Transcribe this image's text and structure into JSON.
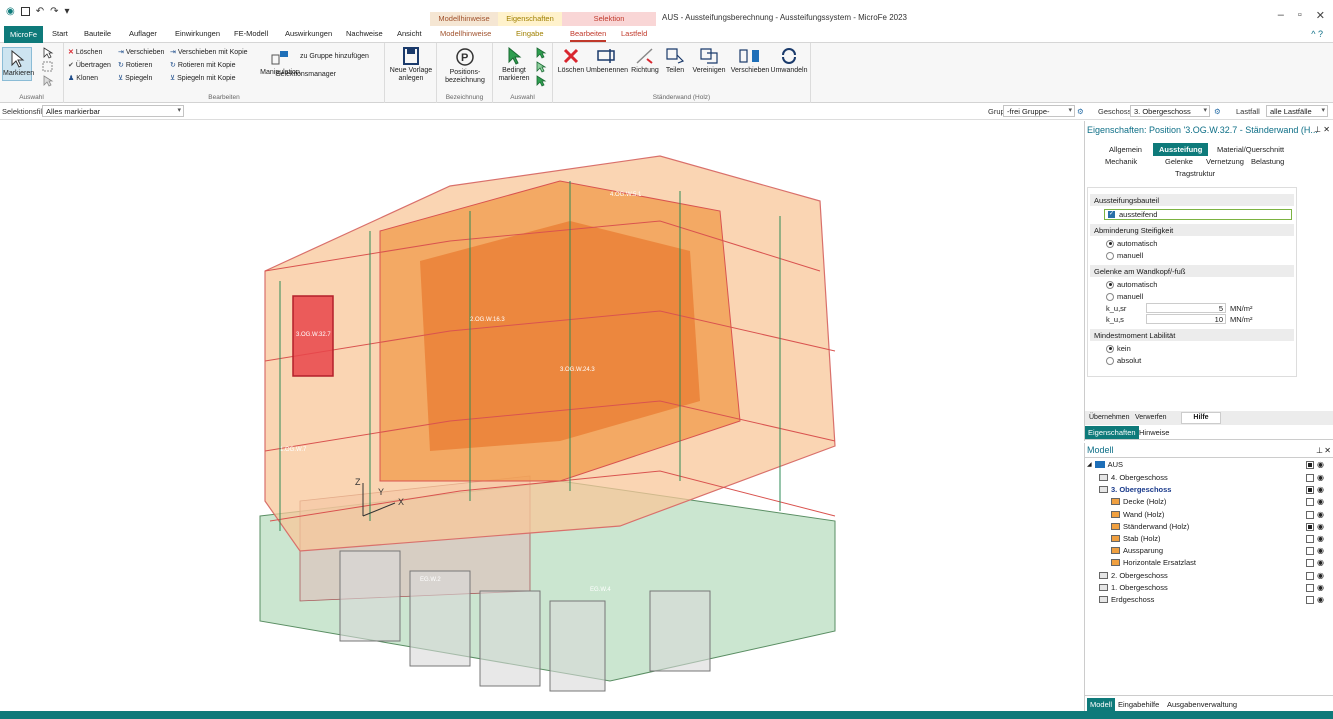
{
  "titlebar": {
    "quick_access": [
      "◉",
      "💾",
      "↶",
      "↷",
      "▾"
    ],
    "window_title": "AUS - Aussteifungsberechnung - Aussteifungssystem - MicroFe 2023",
    "context_groups": [
      {
        "label": "Modellhinweise",
        "color": "#f5e6d3"
      },
      {
        "label": "Eigenschaften",
        "color": "#fff2cc"
      },
      {
        "label": "Selektion",
        "color": "#f9d6d6"
      }
    ],
    "controls": [
      "–",
      "▫",
      "✕"
    ]
  },
  "tabs": {
    "app": "MicroFe",
    "items": [
      "Start",
      "Bauteile",
      "Auflager",
      "Einwirkungen",
      "FE-Modell",
      "Auswirkungen",
      "Nachweise",
      "Ansicht",
      "Modellhinweise",
      "Eingabe",
      "Bearbeiten",
      "Lastfeld"
    ],
    "help": "^ ?"
  },
  "ribbon": {
    "auswahl": {
      "label": "Auswahl",
      "markieren": "Markieren"
    },
    "bearbeiten": {
      "label": "Bearbeiten",
      "loeschen": "Löschen",
      "uebertragen": "Übertragen",
      "klonen": "Klonen",
      "verschieben": "Verschieben",
      "rotieren": "Rotieren",
      "spiegeln": "Spiegeln",
      "verschieben_kopie": "Verschieben mit Kopie",
      "rotieren_kopie": "Rotieren mit Kopie",
      "spiegeln_kopie": "Spiegeln mit Kopie",
      "manipulation": "Manipulation",
      "gruppe": "zu Gruppe hinzufügen",
      "selektionsmanager": "Selektionsmanager",
      "neue_vorlage": "Neue Vorlage anlegen"
    },
    "bezeichnung": {
      "label": "Bezeichnung",
      "positions": "Positions-bezeichnung"
    },
    "auswahl2": {
      "label": "Auswahl",
      "bedingt": "Bedingt markieren"
    },
    "staenderwand": {
      "label": "Ständerwand (Holz)",
      "items": [
        "Löschen",
        "Umbenennen",
        "Richtung",
        "Teilen",
        "Vereinigen",
        "Verschieben",
        "Umwandeln"
      ]
    }
  },
  "selbar": {
    "filter_label": "Selektionsfilter",
    "filter_value": "Alles markierbar",
    "gruppe_label": "Gruppe",
    "gruppe_value": "-frei Gruppe-",
    "geschoss_label": "Geschoss",
    "geschoss_value": "3. Obergeschoss",
    "lastfall_label": "Lastfall",
    "lastfall_value": "alle Lastfälle"
  },
  "props": {
    "title": "Eigenschaften: Position '3.OG.W.32.7 - Ständerwand (H...",
    "tabs": [
      "Allgemein",
      "Aussteifung",
      "Material/Querschnitt",
      "Mechanik",
      "Gelenke",
      "Vernetzung",
      "Belastung",
      "Tragstruktur"
    ],
    "active_tab": "Aussteifung",
    "sections": {
      "aussteifungsbauteil": "Aussteifungsbauteil",
      "aussteifend": "aussteifend",
      "abminderung": "Abminderung Steifigkeit",
      "automatisch": "automatisch",
      "manuell": "manuell",
      "gelenke": "Gelenke am Wandkopf/-fuß",
      "k_u_sr": "k_u,sr",
      "k_u_sr_val": "5",
      "k_u_s": "k_u,s",
      "k_u_s_val": "10",
      "unit": "MN/m²",
      "mindestmoment": "Mindestmoment Labilität",
      "kein": "kein",
      "absolut": "absolut"
    },
    "buttons": [
      "Übernehmen",
      "Verwerfen",
      "Hilfe"
    ],
    "bottom_tabs": [
      "Eigenschaften",
      "Hinweise"
    ]
  },
  "modell": {
    "title": "Modell",
    "root": "AUS",
    "items": [
      {
        "label": "4. Obergeschoss",
        "level": 1,
        "bold": false,
        "checked": false
      },
      {
        "label": "3. Obergeschoss",
        "level": 1,
        "bold": true,
        "checked": true
      },
      {
        "label": "Decke (Holz)",
        "level": 2,
        "bold": false,
        "checked": false
      },
      {
        "label": "Wand (Holz)",
        "level": 2,
        "bold": false,
        "checked": false
      },
      {
        "label": "Ständerwand (Holz)",
        "level": 2,
        "bold": false,
        "checked": true
      },
      {
        "label": "Stab (Holz)",
        "level": 2,
        "bold": false,
        "checked": false
      },
      {
        "label": "Aussparung",
        "level": 2,
        "bold": false,
        "checked": false
      },
      {
        "label": "Horizontale Ersatzlast",
        "level": 2,
        "bold": false,
        "checked": false
      },
      {
        "label": "2. Obergeschoss",
        "level": 1,
        "bold": false,
        "checked": false
      },
      {
        "label": "1. Obergeschoss",
        "level": 1,
        "bold": false,
        "checked": false
      },
      {
        "label": "Erdgeschoss",
        "level": 1,
        "bold": false,
        "checked": false
      }
    ],
    "bottom_tabs": [
      "Modell",
      "Eingabehilfe",
      "Ausgabenverwaltung"
    ]
  },
  "viewport": {
    "axis_x": "X",
    "axis_y": "Y",
    "axis_z": "Z",
    "wall_labels": [
      "3.OG.W.32.7",
      "4.OG.W.5.1",
      "2.OG.W.16.3",
      "3.OG.W.24.3",
      "1.OG.W.7",
      "EG.W.4",
      "EG.W.2"
    ]
  }
}
